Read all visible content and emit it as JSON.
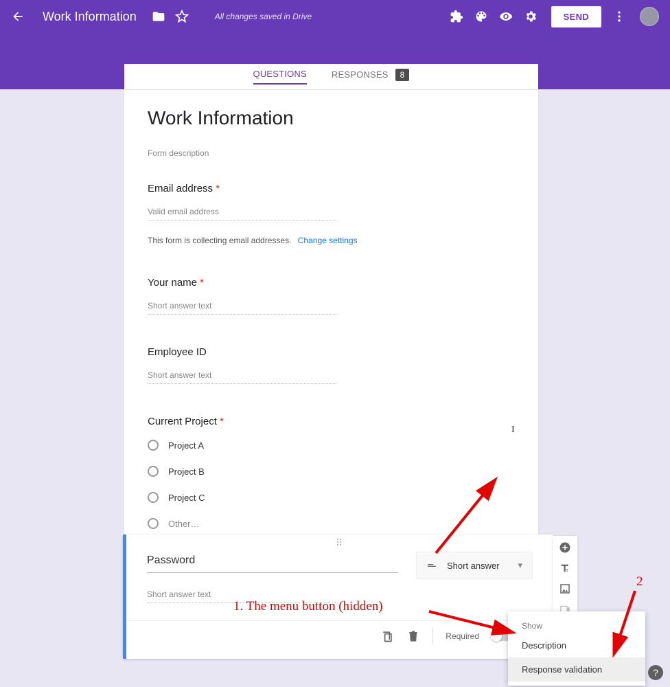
{
  "header": {
    "title": "Work Information",
    "save_status": "All changes saved in Drive",
    "send_label": "SEND"
  },
  "tabs": {
    "questions": "QUESTIONS",
    "responses": "RESPONSES",
    "response_count": "8"
  },
  "form": {
    "title": "Work Information",
    "description": "Form description",
    "email": {
      "label": "Email address",
      "placeholder": "Valid email address",
      "note": "This form is collecting email addresses.",
      "change_link": "Change settings"
    },
    "name": {
      "label": "Your name",
      "placeholder": "Short answer text"
    },
    "employee": {
      "label": "Employee ID",
      "placeholder": "Short answer text"
    },
    "project": {
      "label": "Current Project",
      "options": [
        "Project A",
        "Project B",
        "Project C",
        "Other…"
      ]
    }
  },
  "active_question": {
    "title": "Password",
    "answer_placeholder": "Short answer text",
    "type_label": "Short answer",
    "required_label": "Required"
  },
  "context_menu": {
    "header": "Show",
    "item1": "Description",
    "item2": "Response validation"
  },
  "annotations": {
    "line1": "1. The menu button (hidden)",
    "line2": "2"
  },
  "help": "?"
}
